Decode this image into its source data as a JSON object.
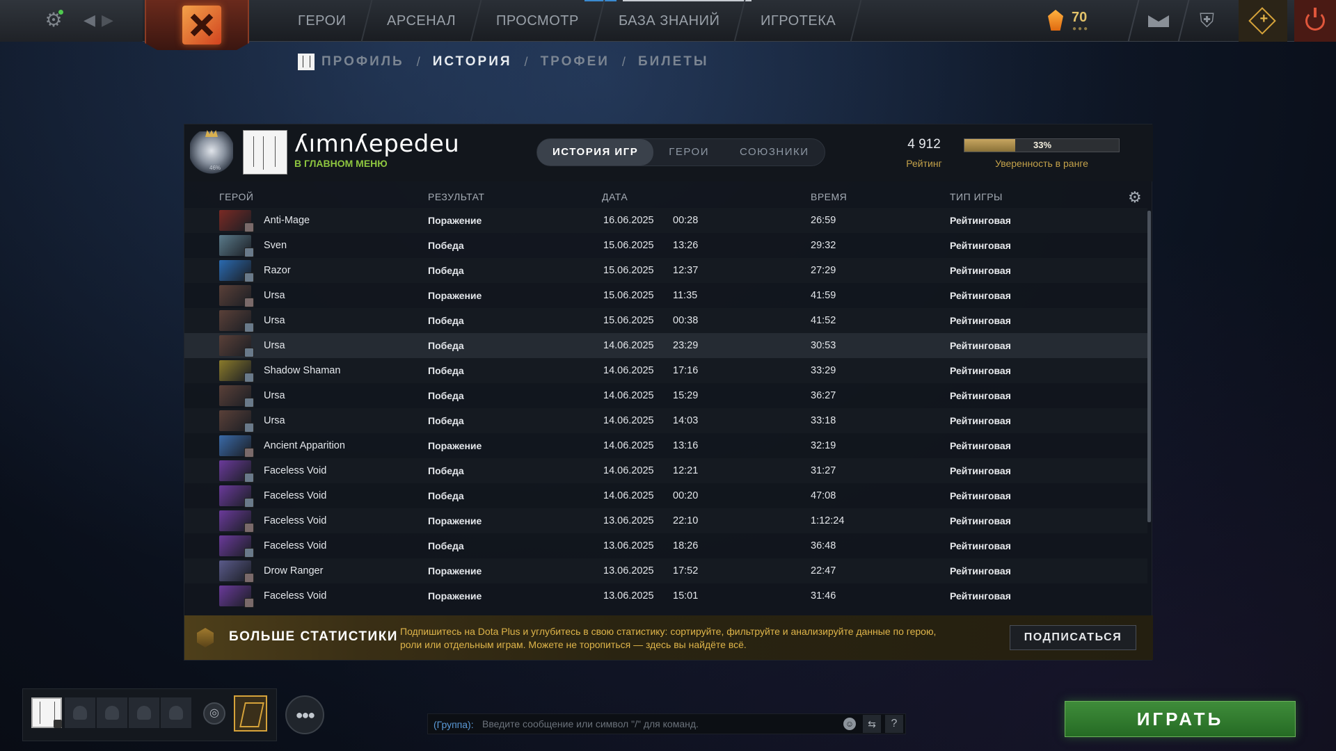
{
  "topbar": {
    "nav": [
      {
        "label": "ГЕРОИ"
      },
      {
        "label": "АРСЕНАЛ"
      },
      {
        "label": "ПРОСМОТР"
      },
      {
        "label": "БАЗА ЗНАНИЙ"
      },
      {
        "label": "ИГРОТЕКА"
      }
    ],
    "level": "70",
    "icons": [
      "gear-icon",
      "arrow-left-icon",
      "arrow-right-icon",
      "dota-logo",
      "shard-icon",
      "mail-icon",
      "armory-icon",
      "dota-plus-icon",
      "power-icon"
    ]
  },
  "subnav": {
    "items": [
      {
        "label": "ПРОФИЛЬ",
        "active": false
      },
      {
        "label": "ИСТОРИЯ",
        "active": true
      },
      {
        "label": "ТРОФЕИ",
        "active": false
      },
      {
        "label": "БИЛЕТЫ",
        "active": false
      }
    ],
    "separator": "/"
  },
  "player": {
    "name": "ʎımnʎepedeu",
    "status": "В ГЛАВНОМ МЕНЮ",
    "rank_percent_label": "46%",
    "rating": "4 912",
    "rating_label": "Рейтинг",
    "confidence": 0.33,
    "confidence_label": "33%",
    "confidence_caption": "Уверенность в ранге"
  },
  "tabs": [
    {
      "label": "ИСТОРИЯ ИГР",
      "active": true
    },
    {
      "label": "ГЕРОИ",
      "active": false
    },
    {
      "label": "СОЮЗНИКИ",
      "active": false
    }
  ],
  "columns": {
    "hero": "ГЕРОЙ",
    "result": "РЕЗУЛЬТАТ",
    "date": "ДАТА",
    "duration": "ВРЕМЯ",
    "type": "ТИП ИГРЫ"
  },
  "matches": [
    {
      "hero": "Anti-Mage",
      "result": "Поражение",
      "win": false,
      "date": "16.06.2025",
      "time": "00:28",
      "duration": "26:59",
      "type": "Рейтинговая",
      "color": "#7a2a24"
    },
    {
      "hero": "Sven",
      "result": "Победа",
      "win": true,
      "date": "15.06.2025",
      "time": "13:26",
      "duration": "29:32",
      "type": "Рейтинговая",
      "color": "#5a7a8a"
    },
    {
      "hero": "Razor",
      "result": "Победа",
      "win": true,
      "date": "15.06.2025",
      "time": "12:37",
      "duration": "27:29",
      "type": "Рейтинговая",
      "color": "#2a6ab0"
    },
    {
      "hero": "Ursa",
      "result": "Поражение",
      "win": false,
      "date": "15.06.2025",
      "time": "11:35",
      "duration": "41:59",
      "type": "Рейтинговая",
      "color": "#5a4038"
    },
    {
      "hero": "Ursa",
      "result": "Победа",
      "win": true,
      "date": "15.06.2025",
      "time": "00:38",
      "duration": "41:52",
      "type": "Рейтинговая",
      "color": "#5a4038"
    },
    {
      "hero": "Ursa",
      "result": "Победа",
      "win": true,
      "date": "14.06.2025",
      "time": "23:29",
      "duration": "30:53",
      "type": "Рейтинговая",
      "color": "#5a4038"
    },
    {
      "hero": "Shadow Shaman",
      "result": "Победа",
      "win": true,
      "date": "14.06.2025",
      "time": "17:16",
      "duration": "33:29",
      "type": "Рейтинговая",
      "color": "#8a7a2a"
    },
    {
      "hero": "Ursa",
      "result": "Победа",
      "win": true,
      "date": "14.06.2025",
      "time": "15:29",
      "duration": "36:27",
      "type": "Рейтинговая",
      "color": "#5a4038"
    },
    {
      "hero": "Ursa",
      "result": "Победа",
      "win": true,
      "date": "14.06.2025",
      "time": "14:03",
      "duration": "33:18",
      "type": "Рейтинговая",
      "color": "#5a4038"
    },
    {
      "hero": "Ancient Apparition",
      "result": "Поражение",
      "win": false,
      "date": "14.06.2025",
      "time": "13:16",
      "duration": "32:19",
      "type": "Рейтинговая",
      "color": "#3a6aa8"
    },
    {
      "hero": "Faceless Void",
      "result": "Победа",
      "win": true,
      "date": "14.06.2025",
      "time": "12:21",
      "duration": "31:27",
      "type": "Рейтинговая",
      "color": "#6a3a9a"
    },
    {
      "hero": "Faceless Void",
      "result": "Победа",
      "win": true,
      "date": "14.06.2025",
      "time": "00:20",
      "duration": "47:08",
      "type": "Рейтинговая",
      "color": "#6a3a9a"
    },
    {
      "hero": "Faceless Void",
      "result": "Поражение",
      "win": false,
      "date": "13.06.2025",
      "time": "22:10",
      "duration": "1:12:24",
      "type": "Рейтинговая",
      "color": "#6a3a9a"
    },
    {
      "hero": "Faceless Void",
      "result": "Победа",
      "win": true,
      "date": "13.06.2025",
      "time": "18:26",
      "duration": "36:48",
      "type": "Рейтинговая",
      "color": "#6a3a9a"
    },
    {
      "hero": "Drow Ranger",
      "result": "Поражение",
      "win": false,
      "date": "13.06.2025",
      "time": "17:52",
      "duration": "22:47",
      "type": "Рейтинговая",
      "color": "#5a5a8a"
    },
    {
      "hero": "Faceless Void",
      "result": "Поражение",
      "win": false,
      "date": "13.06.2025",
      "time": "15:01",
      "duration": "31:46",
      "type": "Рейтинговая",
      "color": "#6a3a9a"
    }
  ],
  "selected_row": 5,
  "stats_banner": {
    "title": "БОЛЬШЕ СТАТИСТИКИ",
    "description": "Подпишитесь на Dota Plus и углубитесь в свою статистику: сортируйте, фильтруйте и анализируйте данные по герою, роли или отдельным играм. Можете не торопиться — здесь вы найдёте всё.",
    "button": "ПОДПИСАТЬСЯ"
  },
  "chat": {
    "channel": "(Группа):",
    "placeholder": "Введите сообщение или символ \"/\" для команд."
  },
  "play_button": "ИГРАТЬ",
  "colors": {
    "win": "#7ac143",
    "loss": "#e0412b",
    "accent_gold": "#c4a24a",
    "play_green": "#3f8c3a"
  }
}
